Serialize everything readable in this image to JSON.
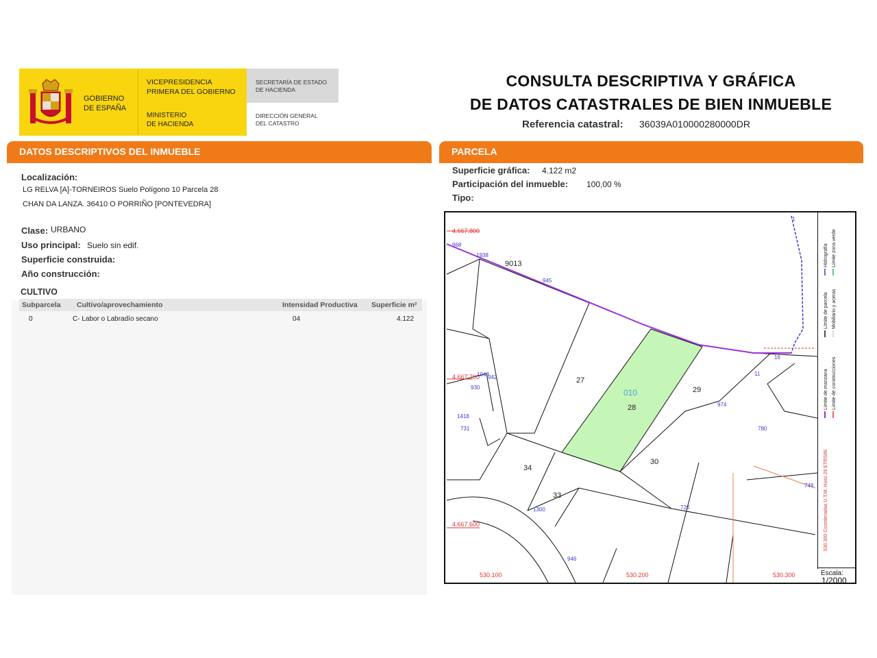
{
  "header": {
    "gobierno": [
      "GOBIERNO",
      "DE ESPAÑA"
    ],
    "vicepresidencia": [
      "VICEPRESIDENCIA",
      "PRIMERA DEL GOBIERNO"
    ],
    "ministerio": [
      "MINISTERIO",
      "DE HACIENDA"
    ],
    "secretaria": [
      "SECRETARÍA DE ESTADO",
      "DE HACIENDA"
    ],
    "direccion": [
      "DIRECCIÓN GENERAL",
      "DEL CATASTRO"
    ],
    "title_line1": "CONSULTA DESCRIPTIVA Y GRÁFICA",
    "title_line2": "DE DATOS CATASTRALES DE BIEN INMUEBLE",
    "ref_label": "Referencia catastral:",
    "ref_value": "36039A010000280000DR"
  },
  "colors": {
    "orange": "#f07a17",
    "yellow": "#f8d50f",
    "parcel_green": "#c6f5b8",
    "boundary_purple": "#9b30d9"
  },
  "left": {
    "section_title": "DATOS DESCRIPTIVOS DEL INMUEBLE",
    "localizacion_label": "Localización:",
    "localizacion_line1": "LG RELVA [A]-TORNEIROS  Suelo Polígono 10 Parcela 28",
    "localizacion_line2": "CHAN DA LANZA. 36410 O PORRIÑO [PONTEVEDRA]",
    "clase_label": "Clase:",
    "clase_value": "URBANO",
    "uso_label": "Uso principal:",
    "uso_value": "Suelo sin edif.",
    "superficie_label": "Superficie construida:",
    "anio_label": "Año construcción:",
    "cultivo_title": "CULTIVO",
    "table_headers": [
      "Subparcela",
      "Cultivo/aprovechamiento",
      "Intensidad Productiva",
      "Superficie m²"
    ],
    "table_rows": [
      [
        "0",
        "C- Labor o Labradío secano",
        "04",
        "4.122"
      ]
    ]
  },
  "right": {
    "section_title": "PARCELA",
    "sup_label": "Superficie gráfica:",
    "sup_value": "4.122 m2",
    "part_label": "Participación del inmueble:",
    "part_value": "100,00 %",
    "tipo_label": "Tipo:"
  },
  "map": {
    "coord_labels": [
      "4.667.800",
      "4.667.700",
      "4.667.600",
      "530.100",
      "530.200",
      "530.300"
    ],
    "parcel_labels": [
      "9013",
      "27",
      "29",
      "30",
      "34",
      "33"
    ],
    "selected_code": "010",
    "selected_number": "28",
    "road_labels": [
      "968",
      "1938",
      "945",
      "1943",
      "942",
      "930",
      "1418",
      "731",
      "11",
      "974",
      "780",
      "748",
      "720",
      "1300",
      "946",
      "16",
      "1"
    ],
    "legend": [
      "Límite de manzana",
      "Límite de parcela",
      "Límite de construcciones",
      "Mobiliario y aceras",
      "Límite zona verde",
      "Hidrografía"
    ],
    "coords_note": "530.300 Coordenadas U.T.M. Huso 29 ETRS89",
    "scale_label": "Escala:",
    "scale_value": "1/2000"
  }
}
